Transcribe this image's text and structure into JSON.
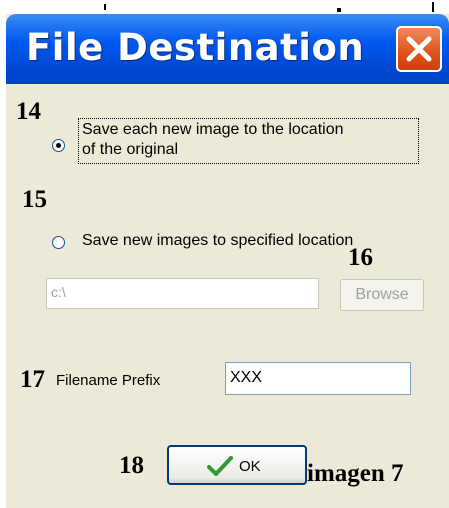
{
  "window": {
    "title": "File Destination",
    "close_icon": "close-icon"
  },
  "annotations": {
    "a14": "14",
    "a15": "15",
    "a16": "16",
    "a17": "17",
    "a18": "18",
    "caption": "imagen 7"
  },
  "options": {
    "save_original": {
      "line1": "Save each new image to the location",
      "line2": "of the original",
      "selected": true
    },
    "save_specified": {
      "label": "Save new images to specified location",
      "selected": false
    }
  },
  "location": {
    "path_value": "c:\\",
    "browse_label": "Browse"
  },
  "prefix": {
    "label": "Filename Prefix",
    "value": "XXX"
  },
  "ok": {
    "label": "OK",
    "icon": "checkmark-icon"
  },
  "colors": {
    "titlebar": "#0058ee",
    "close_button": "#e0521c",
    "dialog_background": "#ece9d8",
    "checkmark": "#2f9a2f"
  }
}
